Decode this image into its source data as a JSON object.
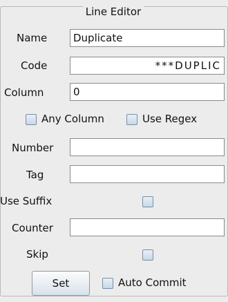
{
  "title": "Line Editor",
  "fields": {
    "name": {
      "label": "Name",
      "value": "Duplicate"
    },
    "code": {
      "label": "Code",
      "value": "***DUPLIC"
    },
    "column": {
      "label": "Column",
      "value": "0"
    },
    "number": {
      "label": "Number",
      "value": ""
    },
    "tag": {
      "label": "Tag",
      "value": ""
    },
    "counter": {
      "label": "Counter",
      "value": ""
    }
  },
  "options": {
    "any_column": "Any Column",
    "use_regex": "Use Regex",
    "use_suffix": "Use Suffix",
    "skip": "Skip",
    "auto_commit": "Auto Commit"
  },
  "buttons": {
    "set": "Set"
  }
}
